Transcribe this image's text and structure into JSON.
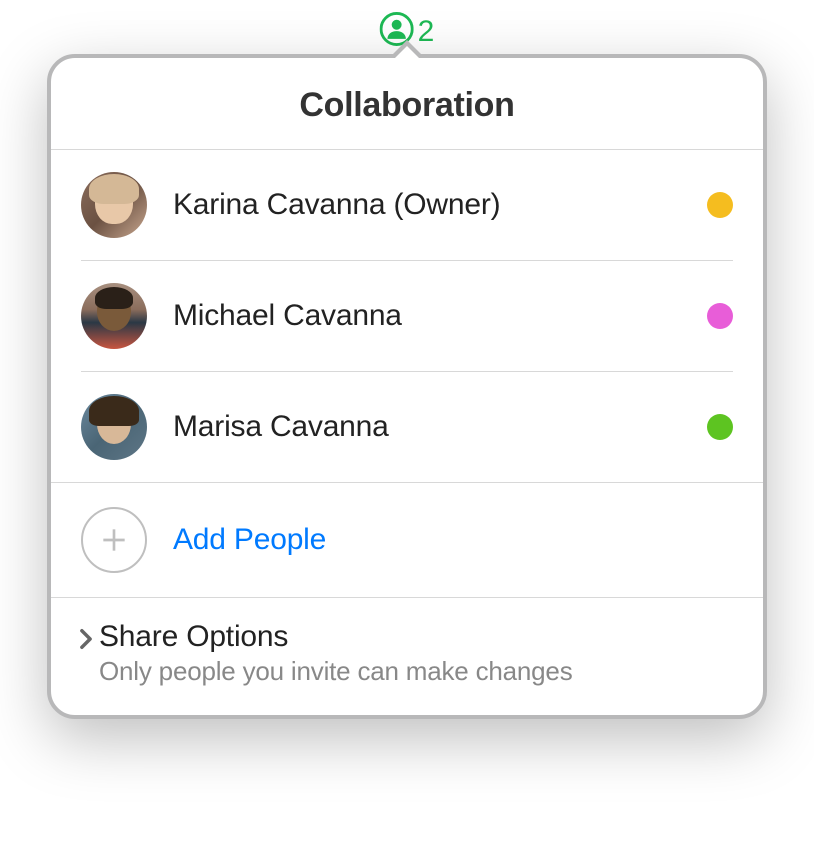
{
  "indicator": {
    "count": "2"
  },
  "popover": {
    "title": "Collaboration",
    "participants": [
      {
        "name": "Karina Cavanna (Owner)",
        "statusColor": "#f5bd1f"
      },
      {
        "name": "Michael Cavanna",
        "statusColor": "#e85dd8"
      },
      {
        "name": "Marisa Cavanna",
        "statusColor": "#5dc421"
      }
    ],
    "addPeople": {
      "label": "Add People"
    },
    "shareOptions": {
      "title": "Share Options",
      "subtitle": "Only people you invite can make changes"
    }
  }
}
